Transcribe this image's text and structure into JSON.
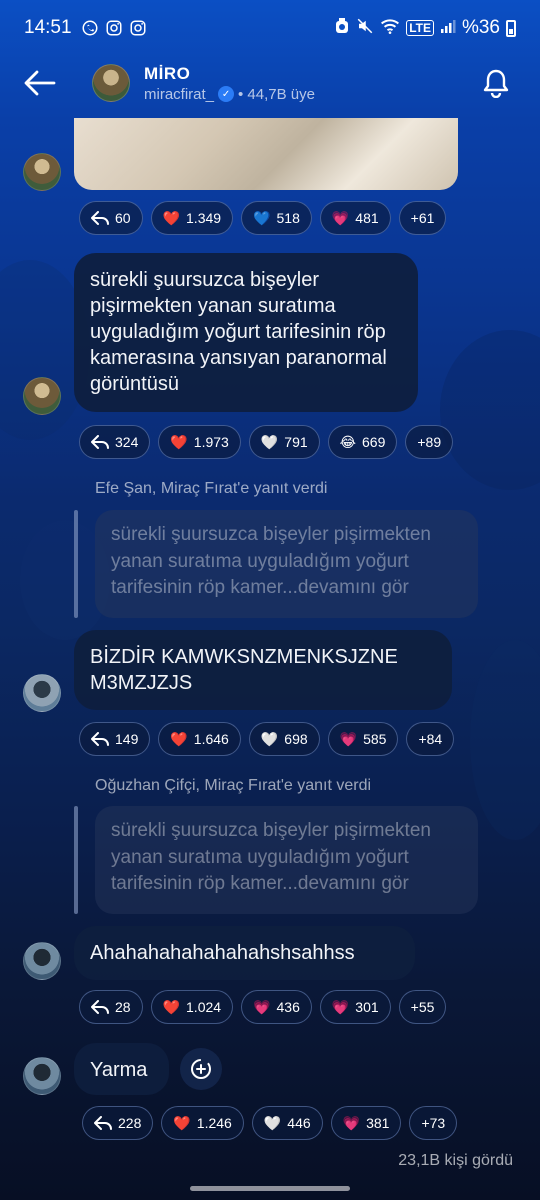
{
  "status_bar": {
    "time": "14:51",
    "left_icons": [
      "whatsapp-icon",
      "instagram-icon",
      "instagram-icon"
    ],
    "right_icons": [
      "alarm-icon",
      "mute-icon",
      "wifi-icon",
      "lte-icon",
      "signal-icon"
    ],
    "battery": "%36"
  },
  "header": {
    "channel_name": "MİRO",
    "handle": "miracfirat_",
    "members": "• 44,7B üye"
  },
  "messages": [
    {
      "author": "miro",
      "reactions": [
        {
          "icon": "reply",
          "count": "60"
        },
        {
          "icon": "❤️",
          "count": "1.349"
        },
        {
          "icon": "💙",
          "count": "518"
        },
        {
          "icon": "💗",
          "count": "481"
        },
        {
          "icon": "",
          "count": "+61"
        }
      ]
    },
    {
      "author": "miro",
      "text": "sürekli şuursuzca bişeyler pişirmekten yanan suratıma uyguladığım yoğurt tarifesinin röp kamerasına yansıyan paranormal görüntüsü",
      "reactions": [
        {
          "icon": "reply",
          "count": "324"
        },
        {
          "icon": "❤️",
          "count": "1.973"
        },
        {
          "icon": "🤍",
          "count": "791"
        },
        {
          "icon": "😂",
          "count": "669"
        },
        {
          "icon": "",
          "count": "+89"
        }
      ]
    },
    {
      "author": "efe",
      "reply_header": "Efe Şan, Miraç Fırat'e yanıt verdi",
      "quote": "sürekli şuursuzca bişeyler pişirmekten yanan suratıma uyguladığım yoğurt tarifesinin röp kamer...devamını gör",
      "text": "BİZDİR KAMWKSNZMENKSJZNE M3MZJZJS",
      "reactions": [
        {
          "icon": "reply",
          "count": "149"
        },
        {
          "icon": "❤️",
          "count": "1.646"
        },
        {
          "icon": "🤍",
          "count": "698"
        },
        {
          "icon": "💗",
          "count": "585"
        },
        {
          "icon": "",
          "count": "+84"
        }
      ]
    },
    {
      "author": "oguzhan",
      "reply_header": "Oğuzhan Çifçi, Miraç Fırat'e yanıt verdi",
      "quote": "sürekli şuursuzca bişeyler pişirmekten yanan suratıma uyguladığım yoğurt tarifesinin röp kamer...devamını gör",
      "text": "Ahahahahahahahahshsahhss",
      "reactions": [
        {
          "icon": "reply",
          "count": "28"
        },
        {
          "icon": "❤️",
          "count": "1.024"
        },
        {
          "icon": "💗",
          "count": "436"
        },
        {
          "icon": "💗",
          "count": "301"
        },
        {
          "icon": "",
          "count": "+55"
        }
      ]
    },
    {
      "author": "oguzhan",
      "text": "Yarma",
      "reactions": [
        {
          "icon": "reply",
          "count": "228"
        },
        {
          "icon": "❤️",
          "count": "1.246"
        },
        {
          "icon": "🤍",
          "count": "446"
        },
        {
          "icon": "💗",
          "count": "381"
        },
        {
          "icon": "",
          "count": "+73"
        }
      ]
    }
  ],
  "footer": {
    "views": "23,1B kişi gördü"
  },
  "colors": {
    "accent_blue": "#2b7cf6",
    "bubble_bg": "#0e1e3e"
  }
}
